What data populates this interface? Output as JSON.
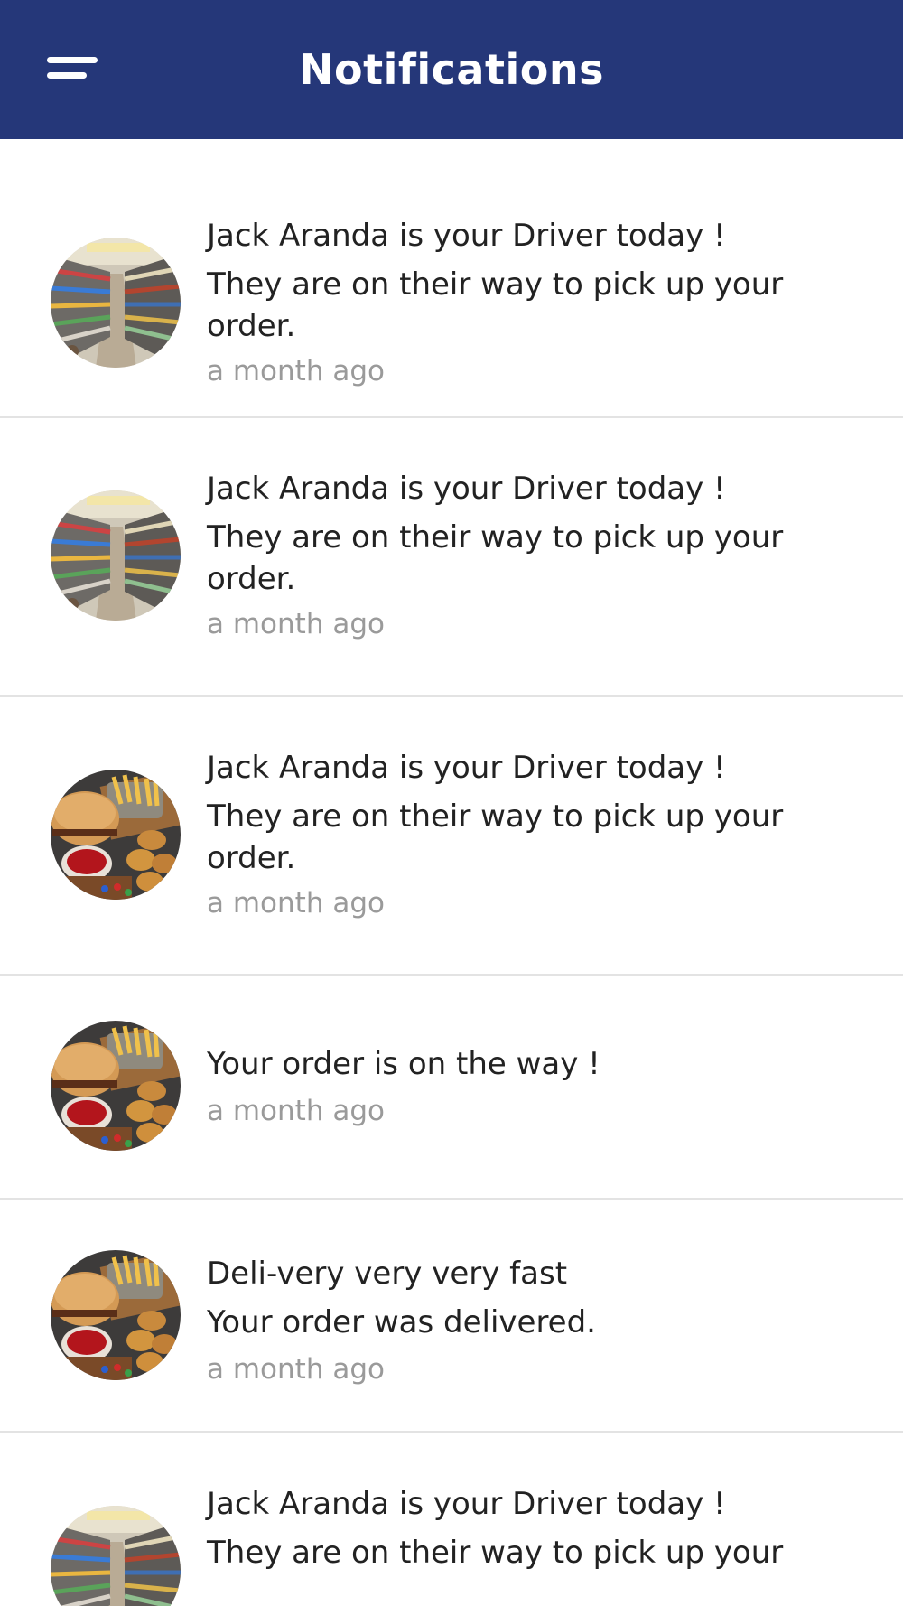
{
  "header": {
    "title": "Notifications",
    "menu_icon": "hamburger-menu-icon",
    "background": "#253779"
  },
  "notifications": [
    {
      "avatar": "store-aisle-image",
      "lines": [
        "Jack Aranda is your Driver today !",
        "They are on their way to pick up your",
        "order."
      ],
      "time": "a month ago"
    },
    {
      "avatar": "store-aisle-image",
      "lines": [
        "Jack Aranda is your Driver today !",
        "They are on their way to pick up your",
        "order."
      ],
      "time": "a month ago"
    },
    {
      "avatar": "burger-fries-image",
      "lines": [
        "Jack Aranda is your Driver today !",
        "They are on their way to pick up your",
        "order."
      ],
      "time": "a month ago"
    },
    {
      "avatar": "burger-fries-image",
      "lines": [
        "Your order is on the way !"
      ],
      "time": "a month ago"
    },
    {
      "avatar": "burger-fries-image",
      "lines": [
        "Deli-very very very fast",
        "Your order was delivered."
      ],
      "time": "a month ago"
    },
    {
      "avatar": "store-aisle-image",
      "lines": [
        "Jack Aranda is your Driver today !",
        "They are on their way to pick up your"
      ],
      "time": ""
    }
  ]
}
